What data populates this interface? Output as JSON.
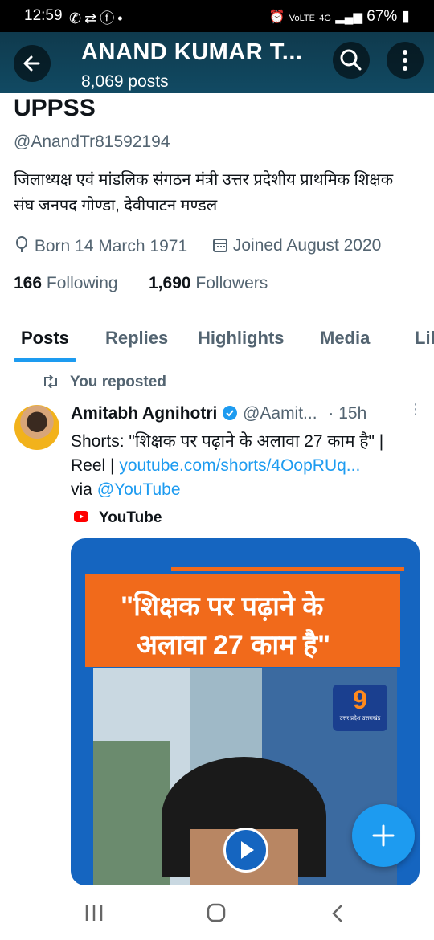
{
  "status_bar": {
    "time": "12:59",
    "left_icons": [
      "whatsapp-icon",
      "repost-icon",
      "facebook-icon",
      "dot-icon"
    ],
    "right_icons": [
      "alarm-icon",
      "volte-icon",
      "4g-icon",
      "signal-icon",
      "battery-icon"
    ],
    "battery": "67%"
  },
  "header": {
    "title": "ANAND KUMAR T...",
    "posts_count": "8,069 posts"
  },
  "profile": {
    "name": "UPPSS",
    "handle": "@AnandTr81592194",
    "bio": "जिलाध्यक्ष एवं मांडलिक संगठन मंत्री उत्तर प्रदेशीय प्राथमिक शिक्षक संघ जनपद गोण्डा, देवीपाटन मण्डल",
    "born": "Born 14 March 1971",
    "joined": "Joined August 2020",
    "following_count": "166",
    "following_label": "Following",
    "followers_count": "1,690",
    "followers_label": "Followers"
  },
  "tabs": [
    "Posts",
    "Replies",
    "Highlights",
    "Media",
    "Likes"
  ],
  "active_tab": "Posts",
  "post": {
    "repost_label": "You reposted",
    "author_name": "Amitabh Agnihotri",
    "author_handle": "@Aamit...",
    "time": "· 15h",
    "text_1": "Shorts: \"शिक्षक पर पढ़ाने के अलावा 27 काम है\" | Reel |",
    "link": "youtube.com/shorts/4OopRUq...",
    "via": "via",
    "mention": "@YouTube",
    "card_source": "YouTube",
    "card_headline_1": "\"शिक्षक पर पढ़ाने के",
    "card_headline_2": "अलावा 27 काम है\"",
    "card_logo": "9",
    "card_logo_sub": "उत्तर प्रदेश उत्तराखंड"
  },
  "colors": {
    "accent": "#1d9bf0",
    "header_bg": "#114a63",
    "card_orange": "#f16a1b",
    "card_blue": "#1565c0"
  }
}
